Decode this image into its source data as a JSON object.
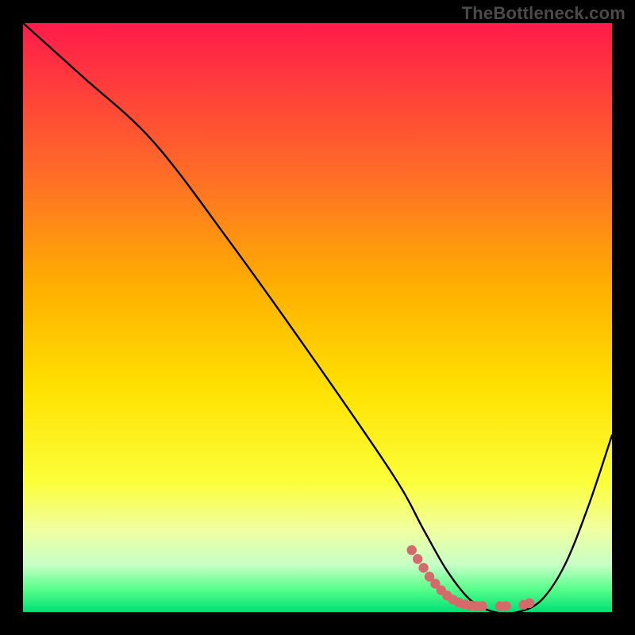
{
  "watermark": "TheBottleneck.com",
  "chart_data": {
    "type": "line",
    "title": "",
    "xlabel": "",
    "ylabel": "",
    "xlim": [
      0,
      100
    ],
    "ylim": [
      0,
      100
    ],
    "grid": false,
    "legend": false,
    "series": [
      {
        "name": "curve",
        "color": "#000000",
        "x": [
          0,
          10,
          22,
          35,
          50,
          63,
          68,
          72,
          76,
          80,
          84,
          88,
          92,
          96,
          100
        ],
        "y": [
          100,
          91,
          80,
          63,
          42,
          23,
          14,
          7,
          2,
          0,
          0,
          2,
          8,
          18,
          30
        ]
      }
    ],
    "markers": {
      "name": "dotted-accent",
      "color": "#d46a6a",
      "points": [
        {
          "x": 66,
          "y": 10.5
        },
        {
          "x": 67,
          "y": 9.0
        },
        {
          "x": 68,
          "y": 7.5
        },
        {
          "x": 69,
          "y": 6.0
        },
        {
          "x": 70,
          "y": 4.8
        },
        {
          "x": 71,
          "y": 3.7
        },
        {
          "x": 72,
          "y": 2.8
        },
        {
          "x": 73,
          "y": 2.1
        },
        {
          "x": 74,
          "y": 1.6
        },
        {
          "x": 75,
          "y": 1.3
        },
        {
          "x": 76,
          "y": 1.1
        },
        {
          "x": 77,
          "y": 1.0
        },
        {
          "x": 78,
          "y": 1.0
        },
        {
          "x": 81,
          "y": 1.0
        },
        {
          "x": 82,
          "y": 1.0
        },
        {
          "x": 85,
          "y": 1.2
        },
        {
          "x": 86,
          "y": 1.5
        }
      ]
    },
    "gradient_stops": [
      {
        "pos": 0.0,
        "color": "#ff1b4b"
      },
      {
        "pos": 0.25,
        "color": "#ff6a28"
      },
      {
        "pos": 0.45,
        "color": "#ffb000"
      },
      {
        "pos": 0.62,
        "color": "#ffe100"
      },
      {
        "pos": 0.78,
        "color": "#fbff3a"
      },
      {
        "pos": 0.86,
        "color": "#f0ffa0"
      },
      {
        "pos": 0.92,
        "color": "#c6ffc6"
      },
      {
        "pos": 0.96,
        "color": "#5bff8c"
      },
      {
        "pos": 1.0,
        "color": "#00e074"
      }
    ]
  }
}
